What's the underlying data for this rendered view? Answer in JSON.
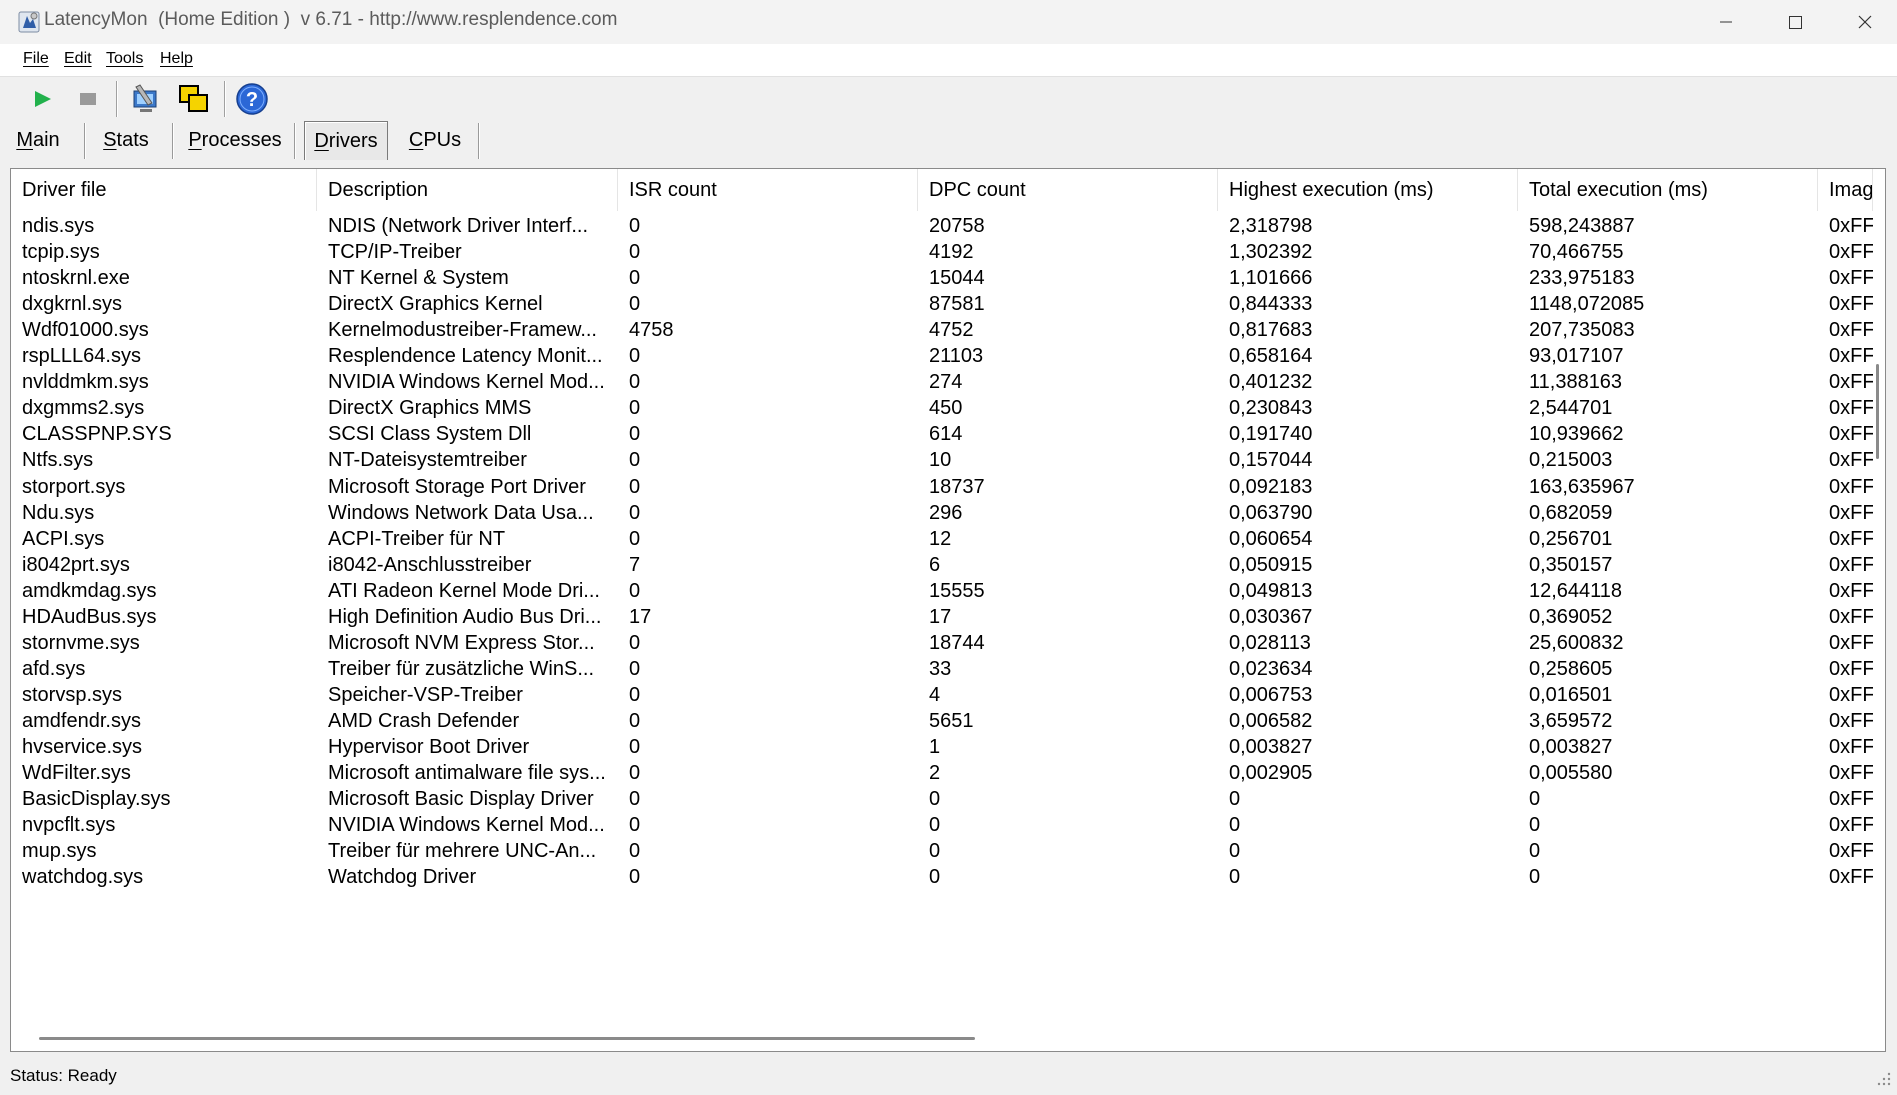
{
  "window": {
    "title": "LatencyMon  (Home Edition )  v 6.71 - http://www.resplendence.com",
    "icon": "latencymon-app-icon",
    "controls": [
      "minimize-icon",
      "maximize-icon",
      "close-icon"
    ]
  },
  "menu": {
    "items": [
      {
        "label": "File",
        "name": "menu-file"
      },
      {
        "label": "Edit",
        "name": "menu-edit"
      },
      {
        "label": "Tools",
        "name": "menu-tools"
      },
      {
        "label": "Help",
        "name": "menu-help"
      }
    ]
  },
  "toolbar": {
    "buttons": [
      {
        "name": "start-button",
        "icon": "play-icon",
        "color": "#22b14c"
      },
      {
        "name": "stop-button",
        "icon": "stop-icon",
        "color": "#9a9a9a"
      },
      {
        "name": "settings-button",
        "icon": "wrench-monitor-icon"
      },
      {
        "name": "windows-button",
        "icon": "overlapping-windows-icon",
        "color": "#f5d300"
      },
      {
        "name": "help-button",
        "icon": "help-icon",
        "color": "#2b67d6"
      }
    ]
  },
  "tabs": {
    "selected": "Drivers",
    "items": [
      {
        "label": "Main",
        "underline": "M",
        "rest": "ain"
      },
      {
        "label": "Stats",
        "underline": "S",
        "rest": "tats"
      },
      {
        "label": "Processes",
        "underline": "P",
        "rest": "rocesses"
      },
      {
        "label": "Drivers",
        "underline": "D",
        "rest": "rivers"
      },
      {
        "label": "CPUs",
        "underline": "C",
        "rest": "PUs"
      }
    ]
  },
  "table": {
    "columns": [
      "Driver file",
      "Description",
      "ISR count",
      "DPC count",
      "Highest execution (ms)",
      "Total execution (ms)",
      "Imag"
    ],
    "rows": [
      [
        "ndis.sys",
        "NDIS (Network Driver Interf...",
        "0",
        "20758",
        "2,318798",
        "598,243887",
        "0xFF"
      ],
      [
        "tcpip.sys",
        "TCP/IP-Treiber",
        "0",
        "4192",
        "1,302392",
        "70,466755",
        "0xFF"
      ],
      [
        "ntoskrnl.exe",
        "NT Kernel & System",
        "0",
        "15044",
        "1,101666",
        "233,975183",
        "0xFF"
      ],
      [
        "dxgkrnl.sys",
        "DirectX Graphics Kernel",
        "0",
        "87581",
        "0,844333",
        "1148,072085",
        "0xFF"
      ],
      [
        "Wdf01000.sys",
        "Kernelmodustreiber-Framew...",
        "4758",
        "4752",
        "0,817683",
        "207,735083",
        "0xFF"
      ],
      [
        "rspLLL64.sys",
        "Resplendence Latency Monit...",
        "0",
        "21103",
        "0,658164",
        "93,017107",
        "0xFF"
      ],
      [
        "nvlddmkm.sys",
        "NVIDIA Windows Kernel Mod...",
        "0",
        "274",
        "0,401232",
        "11,388163",
        "0xFF"
      ],
      [
        "dxgmms2.sys",
        "DirectX Graphics MMS",
        "0",
        "450",
        "0,230843",
        "2,544701",
        "0xFF"
      ],
      [
        "CLASSPNP.SYS",
        "SCSI Class System Dll",
        "0",
        "614",
        "0,191740",
        "10,939662",
        "0xFF"
      ],
      [
        "Ntfs.sys",
        "NT-Dateisystemtreiber",
        "0",
        "10",
        "0,157044",
        "0,215003",
        "0xFF"
      ],
      [
        "storport.sys",
        "Microsoft Storage Port Driver",
        "0",
        "18737",
        "0,092183",
        "163,635967",
        "0xFF"
      ],
      [
        "Ndu.sys",
        "Windows Network Data Usa...",
        "0",
        "296",
        "0,063790",
        "0,682059",
        "0xFF"
      ],
      [
        "ACPI.sys",
        "ACPI-Treiber für NT",
        "0",
        "12",
        "0,060654",
        "0,256701",
        "0xFF"
      ],
      [
        "i8042prt.sys",
        "i8042-Anschlusstreiber",
        "7",
        "6",
        "0,050915",
        "0,350157",
        "0xFF"
      ],
      [
        "amdkmdag.sys",
        "ATI Radeon Kernel Mode Dri...",
        "0",
        "15555",
        "0,049813",
        "12,644118",
        "0xFF"
      ],
      [
        "HDAudBus.sys",
        "High Definition Audio Bus Dri...",
        "17",
        "17",
        "0,030367",
        "0,369052",
        "0xFF"
      ],
      [
        "stornvme.sys",
        "Microsoft NVM Express Stor...",
        "0",
        "18744",
        "0,028113",
        "25,600832",
        "0xFF"
      ],
      [
        "afd.sys",
        "Treiber für zusätzliche WinS...",
        "0",
        "33",
        "0,023634",
        "0,258605",
        "0xFF"
      ],
      [
        "storvsp.sys",
        "Speicher-VSP-Treiber",
        "0",
        "4",
        "0,006753",
        "0,016501",
        "0xFF"
      ],
      [
        "amdfendr.sys",
        "AMD Crash Defender",
        "0",
        "5651",
        "0,006582",
        "3,659572",
        "0xFF"
      ],
      [
        "hvservice.sys",
        "Hypervisor Boot Driver",
        "0",
        "1",
        "0,003827",
        "0,003827",
        "0xFF"
      ],
      [
        "WdFilter.sys",
        "Microsoft antimalware file sys...",
        "0",
        "2",
        "0,002905",
        "0,005580",
        "0xFF"
      ],
      [
        "BasicDisplay.sys",
        "Microsoft Basic Display Driver",
        "0",
        "0",
        "0",
        "0",
        "0xFF"
      ],
      [
        "nvpcflt.sys",
        "NVIDIA Windows Kernel Mod...",
        "0",
        "0",
        "0",
        "0",
        "0xFF"
      ],
      [
        "mup.sys",
        "Treiber für mehrere UNC-An...",
        "0",
        "0",
        "0",
        "0",
        "0xFF"
      ],
      [
        "watchdog.sys",
        "Watchdog Driver",
        "0",
        "0",
        "0",
        "0",
        "0xFF"
      ]
    ]
  },
  "status": {
    "text": "Status: Ready"
  }
}
